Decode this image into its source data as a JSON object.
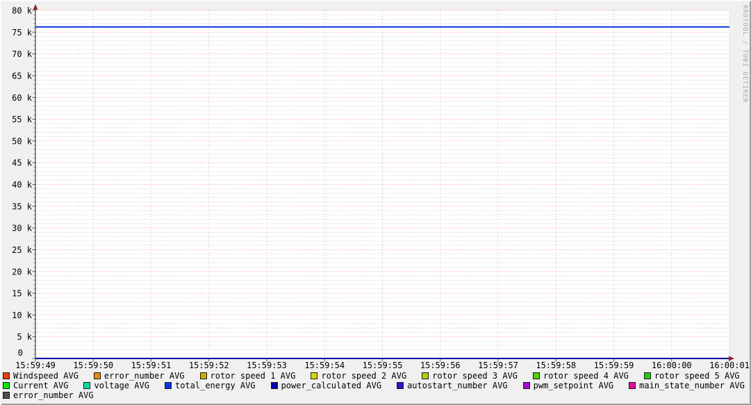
{
  "watermark": "RRDTOOL / TOBI OETIKER",
  "colors": {
    "background": "#f0f0f0",
    "canvas": "#ffffff",
    "minor_grid": "#cbcbcb",
    "major_grid": "#e89f9f",
    "vertical_grid": "#e2a9a9",
    "axis": "#1a1a1a",
    "arrow": "#99221c",
    "tick": "#555555"
  },
  "chart_data": {
    "type": "line",
    "title": "",
    "xlabel": "",
    "ylabel": "",
    "x_tick_labels": [
      "15:59:49",
      "15:59:50",
      "15:59:51",
      "15:59:52",
      "15:59:53",
      "15:59:54",
      "15:59:55",
      "15:59:56",
      "15:59:57",
      "15:59:58",
      "15:59:59",
      "16:00:00",
      "16:00:01"
    ],
    "ylim": [
      0,
      80000
    ],
    "y_major_step": 5000,
    "y_minor_step": 1000,
    "y_tick_labels": [
      "0",
      "5 k",
      "10 k",
      "15 k",
      "20 k",
      "25 k",
      "30 k",
      "35 k",
      "40 k",
      "45 k",
      "50 k",
      "55 k",
      "60 k",
      "65 k",
      "70 k",
      "75 k",
      "80 k"
    ],
    "grid": true,
    "legend_position": "bottom",
    "series": [
      {
        "name": "total_energy AVG",
        "shape": "hline",
        "value": 76200,
        "color": "#0d33e0",
        "width": 2
      },
      {
        "name": "remaining series (flat at zero)",
        "shape": "hline",
        "value": 0,
        "color": "#0000a0",
        "width": 2
      }
    ]
  },
  "legend": {
    "rows": [
      [
        {
          "label": "Windspeed AVG",
          "color": "#e6400e"
        },
        {
          "label": "error_number AVG",
          "color": "#e78a0a"
        },
        {
          "label": "rotor speed 1 AVG",
          "color": "#ceac00"
        },
        {
          "label": "rotor speed 2 AVG",
          "color": "#d8d606"
        },
        {
          "label": "rotor speed 3 AVG",
          "color": "#a5d606"
        },
        {
          "label": "rotor speed 4 AVG",
          "color": "#55d10a"
        },
        {
          "label": "rotor speed 5 AVG",
          "color": "#22cb10"
        }
      ],
      [
        {
          "label": "Current AVG",
          "color": "#0ce70c"
        },
        {
          "label": "voltage AVG",
          "color": "#0cdca4"
        },
        {
          "label": "total_energy AVG",
          "color": "#0d33e0"
        },
        {
          "label": "power_calculated AVG",
          "color": "#0505a8"
        },
        {
          "label": "autostart_number AVG",
          "color": "#3a0fd0"
        },
        {
          "label": "pwm_setpoint AVG",
          "color": "#a80cd4"
        },
        {
          "label": "main_state_number AVG",
          "color": "#da0f9e"
        }
      ],
      [
        {
          "label": "error_number AVG",
          "color": "#4f4f4f"
        }
      ]
    ]
  }
}
